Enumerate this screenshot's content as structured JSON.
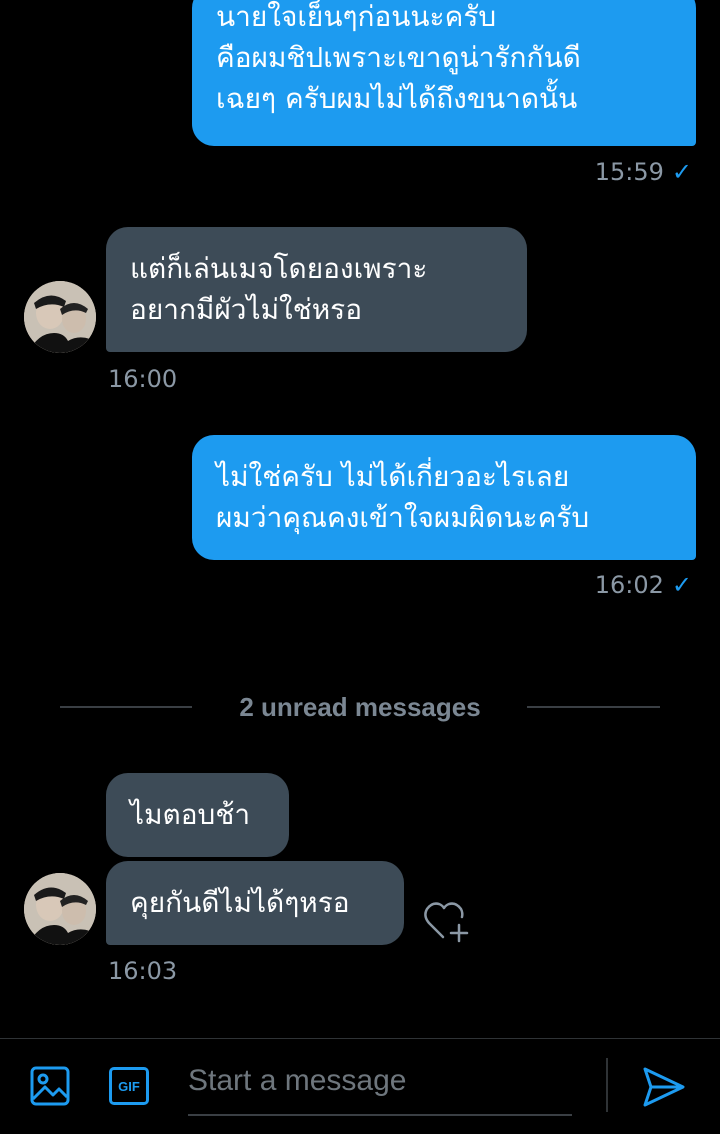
{
  "messages": [
    {
      "lines": [
        "นายใจเย็นๆก่อนนะครับ",
        "คือผมชิปเพราะเขาดูน่ารักกันดี",
        "เฉยๆ ครับผมไม่ได้ถึงขนาดนั้น"
      ],
      "time": "15:59"
    },
    {
      "lines": [
        "แต่ก็เล่นเมจโดยองเพราะ",
        "อยากมีผัวไม่ใช่หรอ"
      ],
      "time": "16:00"
    },
    {
      "lines": [
        "ไม่ใช่ครับ ไม่ได้เกี่ยวอะไรเลย",
        "ผมว่าคุณคงเข้าใจผมผิดนะครับ"
      ],
      "time": "16:02"
    },
    {
      "lines": [
        "ไมตอบช้า"
      ]
    },
    {
      "lines": [
        "คุยกันดีไม่ได้ๆหรอ"
      ],
      "time": "16:03"
    }
  ],
  "read_check": "✓",
  "divider": {
    "label": "2 unread messages"
  },
  "composer": {
    "placeholder": "Start a message",
    "gif_label": "GIF"
  },
  "colors": {
    "outgoing_bubble": "#1d9bf0",
    "incoming_bubble": "#3d4b57",
    "background": "#000000",
    "accent": "#1d9bf0",
    "timestamp": "#8b98a5"
  },
  "icons": {
    "image": "image-icon",
    "gif": "gif-icon",
    "send": "send-icon",
    "react": "heart-plus-icon",
    "read": "checkmark-icon"
  }
}
